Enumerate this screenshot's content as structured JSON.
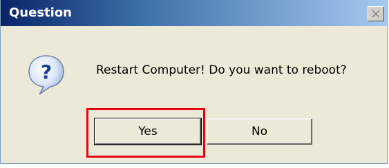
{
  "window": {
    "title": "Question",
    "close_icon": "close-icon"
  },
  "content": {
    "icon": "question-icon",
    "message": "Restart Computer! Do you want to reboot?"
  },
  "buttons": {
    "yes_label": "Yes",
    "no_label": "No"
  },
  "colors": {
    "highlight": "#e8000f",
    "titlebar_start": "#0a246a",
    "titlebar_end": "#a6caf0",
    "dialog_bg": "#ece9d8"
  }
}
